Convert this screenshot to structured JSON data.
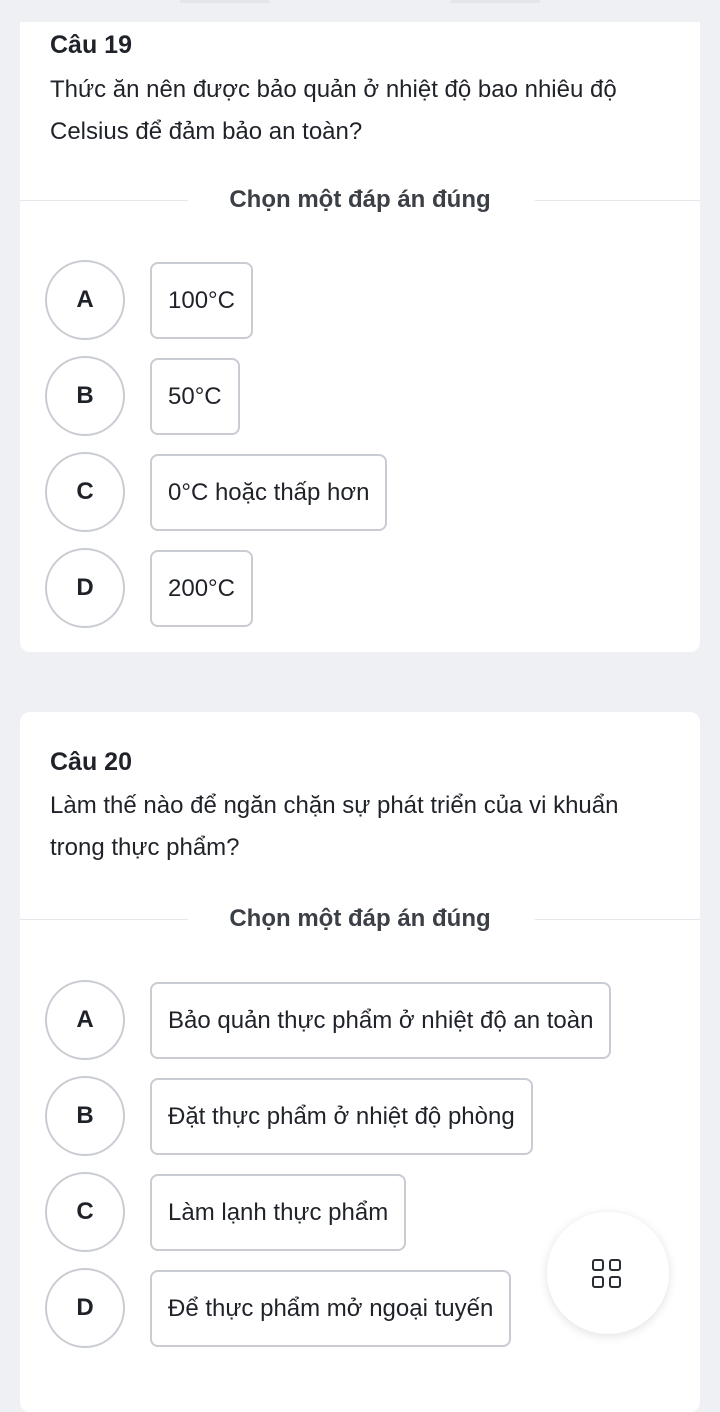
{
  "questions": [
    {
      "number": "Câu 19",
      "text": "Thức ăn nên được bảo quản ở nhiệt độ bao nhiêu độ Celsius để đảm bảo an toàn?",
      "instruction": "Chọn một đáp án đúng",
      "options": [
        {
          "letter": "A",
          "text": "100°C"
        },
        {
          "letter": "B",
          "text": "50°C"
        },
        {
          "letter": "C",
          "text": "0°C hoặc thấp hơn"
        },
        {
          "letter": "D",
          "text": "200°C"
        }
      ]
    },
    {
      "number": "Câu 20",
      "text": "Làm thế nào để ngăn chặn sự phát triển của vi khuẩn trong thực phẩm?",
      "instruction": "Chọn một đáp án đúng",
      "options": [
        {
          "letter": "A",
          "text": "Bảo quản thực phẩm ở nhiệt độ an toàn"
        },
        {
          "letter": "B",
          "text": "Đặt thực phẩm ở nhiệt độ phòng"
        },
        {
          "letter": "C",
          "text": "Làm lạnh thực phẩm"
        },
        {
          "letter": "D",
          "text": "Để thực phẩm mở ngoại tuyến"
        }
      ]
    }
  ],
  "fab": {
    "icon": "grid-icon"
  }
}
